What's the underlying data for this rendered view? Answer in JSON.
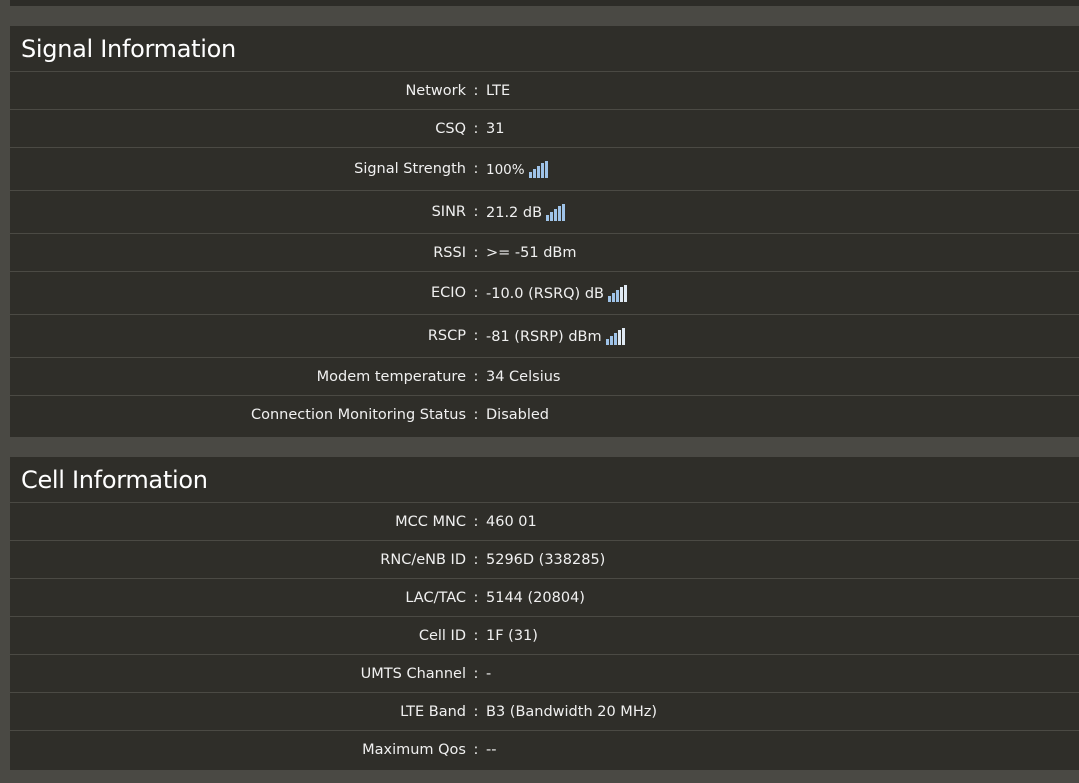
{
  "signal": {
    "title": "Signal Information",
    "rows": [
      {
        "label": "Network",
        "value": "LTE"
      },
      {
        "label": "CSQ",
        "value": "31"
      },
      {
        "label": "Signal Strength",
        "value": "100%",
        "icon": "signal-bars-icon"
      },
      {
        "label": "SINR",
        "value": "21.2 dB",
        "icon": "signal-bars-icon"
      },
      {
        "label": "RSSI",
        "value": ">= -51 dBm"
      },
      {
        "label": "ECIO",
        "value": "-10.0 (RSRQ) dB",
        "icon": "signal-bars-icon"
      },
      {
        "label": "RSCP",
        "value": "-81 (RSRP) dBm",
        "icon": "signal-bars-icon"
      },
      {
        "label": "Modem temperature",
        "value": "34 Celsius"
      },
      {
        "label": "Connection Monitoring Status",
        "value": "Disabled"
      }
    ]
  },
  "cell": {
    "title": "Cell Information",
    "rows": [
      {
        "label": "MCC MNC",
        "value": "460 01"
      },
      {
        "label": "RNC/eNB ID",
        "value": "5296D (338285)"
      },
      {
        "label": "LAC/TAC",
        "value": "5144 (20804)"
      },
      {
        "label": "Cell ID",
        "value": "1F (31)"
      },
      {
        "label": "UMTS Channel",
        "value": "-"
      },
      {
        "label": "LTE Band",
        "value": "B3 (Bandwidth 20 MHz)"
      },
      {
        "label": "Maximum Qos",
        "value": "--"
      }
    ]
  },
  "separator": ":",
  "colors": {
    "page_bg": "#4a4944",
    "panel_bg": "#2f2e29",
    "signal_icon": "#9fc3e8"
  }
}
